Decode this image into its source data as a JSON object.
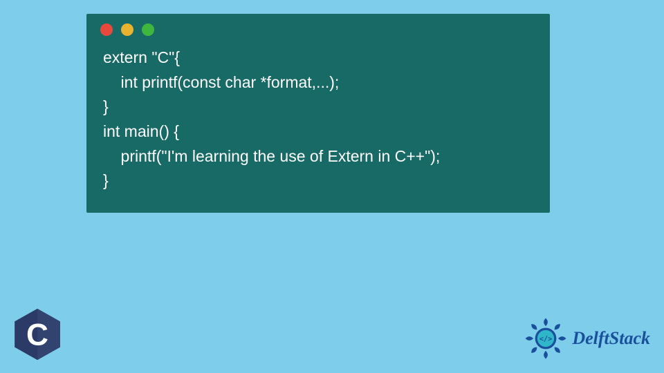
{
  "window": {
    "dots": [
      "red",
      "yellow",
      "green"
    ]
  },
  "code": {
    "line1": "extern \"C\"{",
    "line2": "    int printf(const char *format,...);",
    "line3": "}",
    "line4": "int main() {",
    "line5": "    printf(\"I'm learning the use of Extern in C++\");",
    "line6": "}"
  },
  "logos": {
    "c_letter": "C",
    "delft_text": "DelftStack",
    "delft_badge_inner": "</>"
  },
  "colors": {
    "background": "#7ecdea",
    "window": "#186a66",
    "code_text": "#ffffff",
    "c_logo_hex": "#2b3a67",
    "c_logo_letter": "#ffffff",
    "delft_primary": "#1a4f9c",
    "delft_accent": "#2fb7c9"
  }
}
